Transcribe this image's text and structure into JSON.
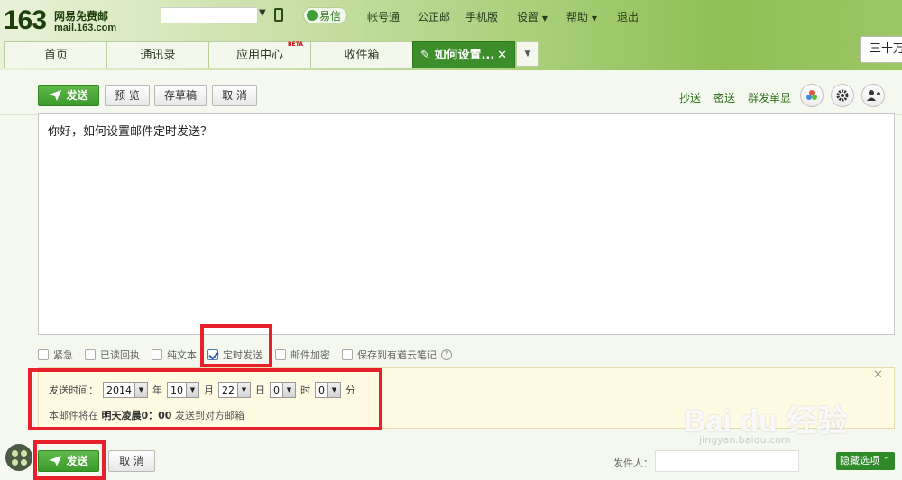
{
  "brand": {
    "number": "163",
    "name": "网易免费邮",
    "url": "mail.163.com"
  },
  "header": {
    "yixin": "易信",
    "nav": [
      "帐号通",
      "公正邮",
      "手机版",
      "设置",
      "帮助",
      "退出"
    ]
  },
  "tabs": [
    {
      "label": "首页"
    },
    {
      "label": "通讯录"
    },
    {
      "label": "应用中心",
      "badge": "BETA"
    },
    {
      "label": "收件箱"
    },
    {
      "label": "如何设置...",
      "active": true
    }
  ],
  "side_popup": "三十万本",
  "toolbar": {
    "send": "发送",
    "preview": "预 览",
    "draft": "存草稿",
    "cancel": "取 消",
    "links": [
      "抄送",
      "密送",
      "群发单显"
    ]
  },
  "editor": {
    "body": "你好，如何设置邮件定时发送？"
  },
  "options": [
    {
      "label": "紧急",
      "checked": false
    },
    {
      "label": "已读回执",
      "checked": false
    },
    {
      "label": "纯文本",
      "checked": false
    },
    {
      "label": "定时发送",
      "checked": true
    },
    {
      "label": "邮件加密",
      "checked": false
    },
    {
      "label": "保存到有道云笔记",
      "checked": false
    }
  ],
  "schedule": {
    "label": "发送时间：",
    "year": "2014",
    "year_unit": "年",
    "month": "10",
    "month_unit": "月",
    "day": "22",
    "day_unit": "日",
    "hour": "0",
    "hour_unit": "时",
    "minute": "0",
    "minute_unit": "分",
    "note_prefix": "本邮件将在",
    "note_time": "明天凌晨0：00",
    "note_suffix": "发送到对方邮箱"
  },
  "bottom": {
    "send": "发送",
    "cancel": "取 消",
    "sender_label": "发件人：",
    "hide_options": "隐藏选项"
  },
  "watermark": {
    "logo": "Bai du 经验",
    "url": "jingyan.baidu.com"
  },
  "colors": {
    "accent_green": "#3c9a2c",
    "highlight_red": "#e8202b",
    "schedule_bg": "#fffbe3"
  }
}
